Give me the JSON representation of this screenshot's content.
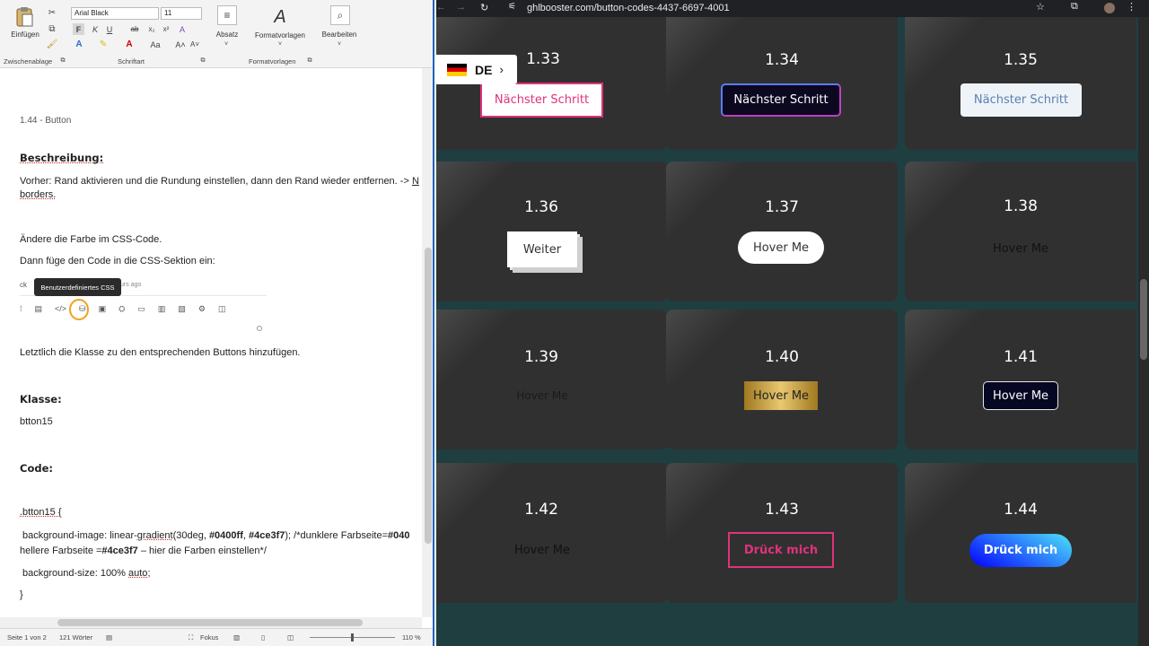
{
  "word": {
    "ribbon": {
      "paste_label": "Einfügen",
      "clipboard_group": "Zwischenablage",
      "font_name": "Arial Black",
      "font_size": "11",
      "font_group": "Schriftart",
      "paragraph_label": "Absatz",
      "styles_label": "Formatvorlagen",
      "styles_group": "Formatvorlagen",
      "edit_label": "Bearbeiten",
      "bold": "F",
      "italic": "K",
      "underline": "U"
    },
    "doc": {
      "heading_small": "1.44 - Button",
      "desc_heading": "Beschreibung:",
      "desc_line1": "Vorher: Rand aktivieren und die Rundung einstellen, dann den Rand wieder entfernen. ->",
      "desc_link": "N",
      "desc_line2": "borders.",
      "color_line": "Ändere die Farbe im CSS-Code.",
      "css_line": "Dann füge den Code in die CSS-Sektion ein:",
      "screenshot_fragment": "ck",
      "screenshot_ago": "urs ago",
      "tooltip": "Benutzerdefiniertes CSS",
      "class_line": "Letztlich die Klasse zu den entsprechenden Buttons hinzufügen.",
      "class_heading": "Klasse:",
      "class_value": "btton15",
      "code_heading": "Code:",
      "code_1": ".btton15 {",
      "code_2a": "background-image: linear-",
      "code_2b": "gradient",
      "code_2c": "(30deg, ",
      "code_2d": "#0400ff",
      "code_2e": ", ",
      "code_2f": "#4ce3f7",
      "code_2g": "); /*dunklere Farbseite=",
      "code_2h": "#040",
      "code_3a": "hellere Farbseite =",
      "code_3b": "#4ce3f7",
      "code_3c": " – hier die Farben einstellen*/",
      "code_4a": "background-size: 100% ",
      "code_4b": "auto",
      "code_4c": ";",
      "code_5": "}"
    },
    "status": {
      "page": "Seite 1 von 2",
      "words": "121 Wörter",
      "focus": "Fokus",
      "zoom": "110 %"
    }
  },
  "browser": {
    "url": "ghlbooster.com/button-codes-4437-6697-4001",
    "lang": "DE",
    "cards": [
      {
        "num": "1.33",
        "label": "Nächster Schritt"
      },
      {
        "num": "1.34",
        "label": "Nächster Schritt"
      },
      {
        "num": "1.35",
        "label": "Nächster Schritt"
      },
      {
        "num": "1.36",
        "label": "Weiter"
      },
      {
        "num": "1.37",
        "label": "Hover Me"
      },
      {
        "num": "1.38",
        "label": "Hover Me"
      },
      {
        "num": "1.39",
        "label": "Hover Me"
      },
      {
        "num": "1.40",
        "label": "Hover Me"
      },
      {
        "num": "1.41",
        "label": "Hover Me"
      },
      {
        "num": "1.42",
        "label": "Hover Me"
      },
      {
        "num": "1.43",
        "label": "Drück mich"
      },
      {
        "num": "1.44",
        "label": "Drück mich"
      }
    ]
  },
  "colors": {
    "page_bg": "#1f3e40",
    "card_bg": "#303030",
    "pink": "#e0327a",
    "blue_gradient_start": "#0400ff",
    "blue_gradient_end": "#4ce3f7",
    "gold": "#c9a13a"
  }
}
